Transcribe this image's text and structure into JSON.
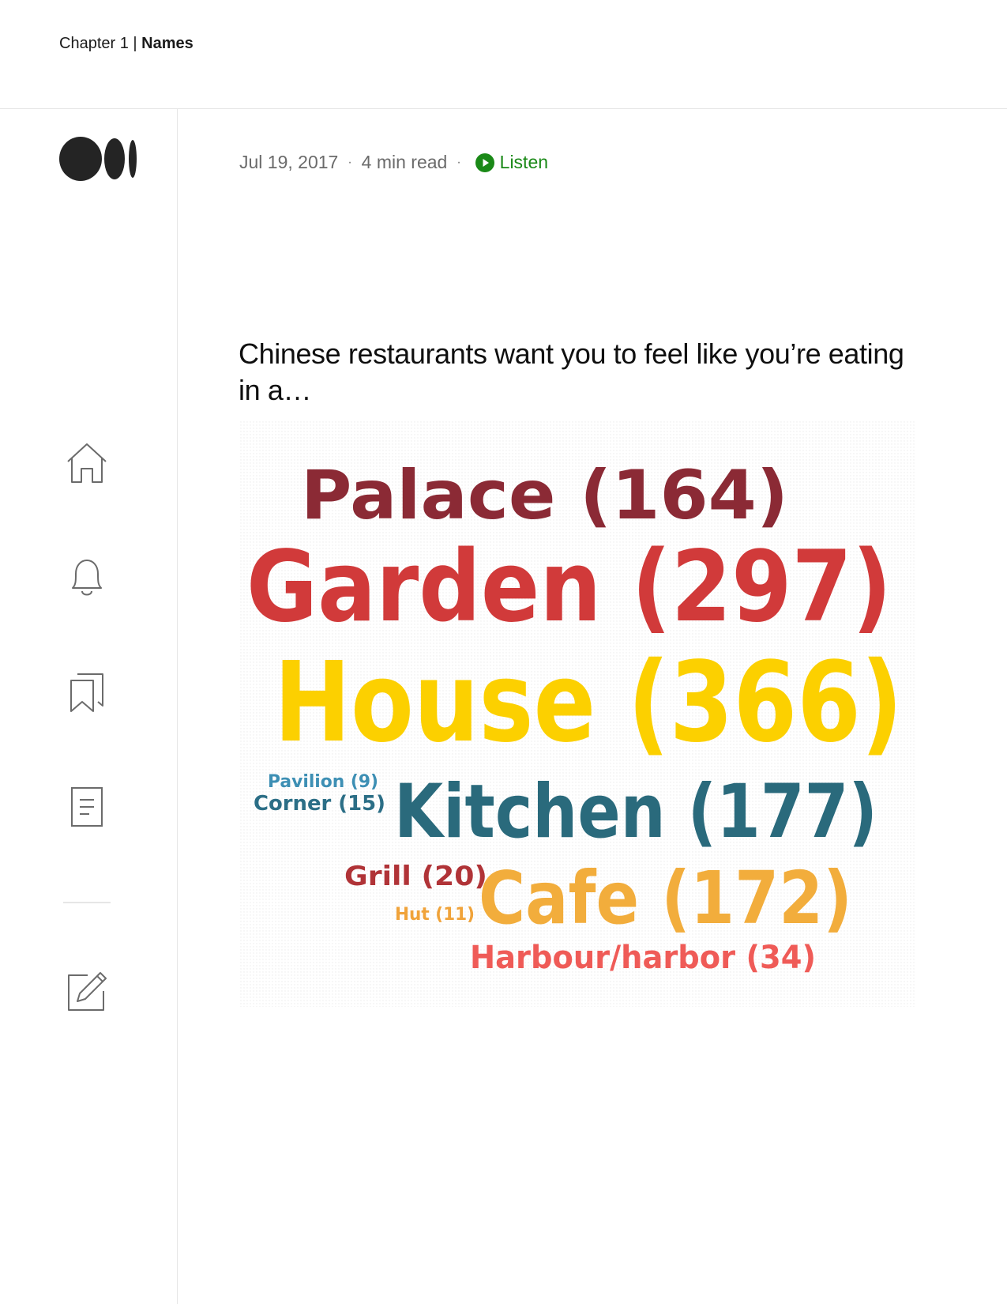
{
  "header": {
    "chapter_label": "Chapter 1",
    "divider": "|",
    "section_name": "Names"
  },
  "sidebar": {
    "logo": "medium-logo",
    "items": [
      {
        "name": "home",
        "icon": "home-icon"
      },
      {
        "name": "notifications",
        "icon": "bell-icon"
      },
      {
        "name": "bookmarks",
        "icon": "bookmark-icon"
      },
      {
        "name": "stories",
        "icon": "document-icon"
      },
      {
        "name": "write",
        "icon": "edit-icon"
      }
    ]
  },
  "article": {
    "date": "Jul 19, 2017",
    "sep1": "·",
    "read_time": "4 min read",
    "sep2": "·",
    "listen_label": "Listen",
    "title": "Chinese restaurants want you to feel like you’re eating in a…"
  },
  "word_cloud": {
    "words": [
      {
        "text": "Palace (164)",
        "color": "#8b2a35"
      },
      {
        "text": "Garden (297)",
        "color": "#d13a3a"
      },
      {
        "text": "House (366)",
        "color": "#fcd000"
      },
      {
        "text": "Pavilion (9)",
        "color": "#3d8fb4"
      },
      {
        "text": "Corner (15)",
        "color": "#2b6e86"
      },
      {
        "text": "Kitchen (177)",
        "color": "#2a6a7c"
      },
      {
        "text": "Grill (20)",
        "color": "#b03337"
      },
      {
        "text": "Cafe (172)",
        "color": "#f2ad3c"
      },
      {
        "text": "Hut (11)",
        "color": "#f0a33a"
      },
      {
        "text": "Harbour/harbor (34)",
        "color": "#ef5b57"
      }
    ]
  },
  "colors": {
    "listen_green": "#1a8917",
    "text_dark": "#242424",
    "meta_gray": "#6b6b6b",
    "border": "#e6e6e6"
  }
}
